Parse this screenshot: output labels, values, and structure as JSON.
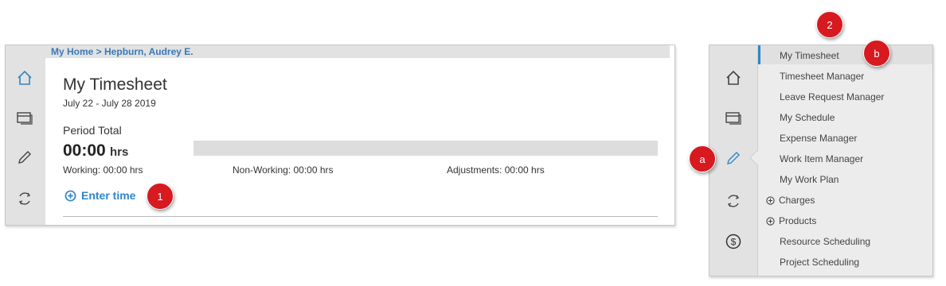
{
  "left_panel": {
    "breadcrumb": "My Home > Hepburn, Audrey E.",
    "title": "My Timesheet",
    "date_range": "July 22 - July 28 2019",
    "period_total_label": "Period Total",
    "hours_value": "00:00",
    "hours_unit": "hrs",
    "working": "Working: 00:00 hrs",
    "non_working": "Non-Working: 00:00 hrs",
    "adjustments": "Adjustments: 00:00 hrs",
    "enter_time": "Enter time",
    "rail_icons": [
      "home-icon",
      "window-icon",
      "pencil-icon",
      "sync-icon"
    ]
  },
  "badges": {
    "one": "1",
    "two": "2",
    "a": "a",
    "b": "b"
  },
  "right_panel": {
    "rail_icons": [
      "home-icon",
      "window-icon",
      "pencil-icon",
      "sync-icon",
      "dollar-icon"
    ],
    "menu_items": [
      "My Timesheet",
      "Timesheet Manager",
      "Leave Request Manager",
      "My Schedule",
      "Expense Manager",
      "Work Item Manager",
      "My Work Plan",
      "Charges",
      "Products",
      "Resource Scheduling",
      "Project Scheduling"
    ],
    "selected_item": "My Timesheet"
  },
  "colors": {
    "accent": "#2f86c9",
    "breadcrumb": "#3a79b8",
    "badge": "#d71920",
    "rail": "#e2e2e2"
  }
}
